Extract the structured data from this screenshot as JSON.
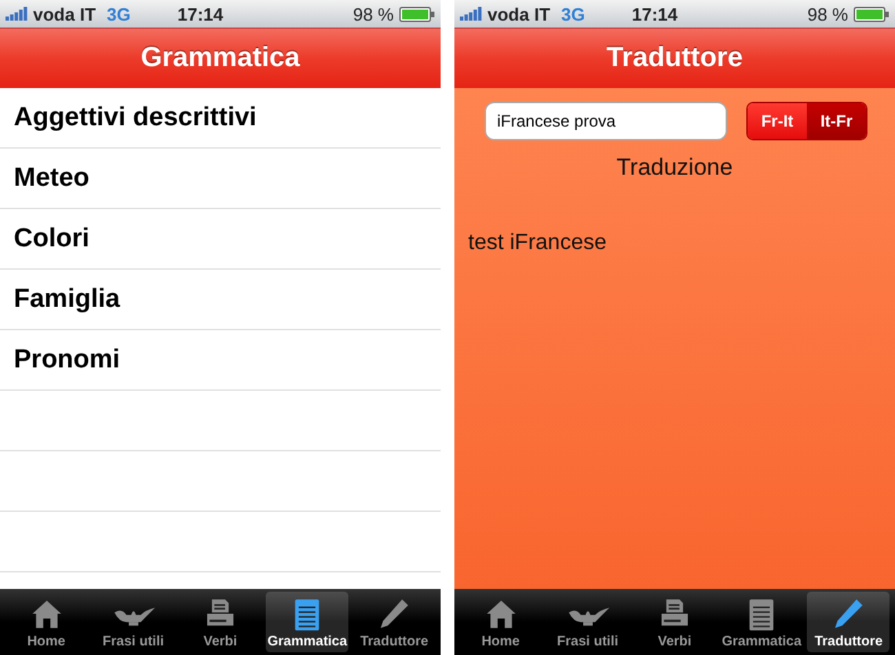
{
  "screens": [
    {
      "status_bar": {
        "carrier": "voda IT",
        "network": "3G",
        "time": "17:14",
        "battery": "98 %"
      },
      "nav_bar": {
        "title": "Grammatica"
      },
      "kind": "list",
      "list": {
        "items": [
          "Aggettivi descrittivi",
          "Meteo",
          "Colori",
          "Famiglia",
          "Pronomi"
        ]
      },
      "tab_bar": [
        {
          "label": "Home",
          "kind": "home",
          "selected": false
        },
        {
          "label": "Frasi utili",
          "kind": "lamp",
          "selected": false
        },
        {
          "label": "Verbi",
          "kind": "printer",
          "selected": false
        },
        {
          "label": "Grammatica",
          "kind": "notepad",
          "selected": true
        },
        {
          "label": "Traduttore",
          "kind": "pencil",
          "selected": false
        }
      ]
    },
    {
      "status_bar": {
        "carrier": "voda IT",
        "network": "3G",
        "time": "17:14",
        "battery": "98 %"
      },
      "nav_bar": {
        "title": "Traduttore"
      },
      "kind": "translator",
      "translator": {
        "input": {
          "value": "iFrancese prova"
        },
        "segments": [
          {
            "label": "Fr-It",
            "selected": false
          },
          {
            "label": "It-Fr",
            "selected": true
          }
        ],
        "heading": "Traduzione",
        "result": "test iFrancese"
      },
      "tab_bar": [
        {
          "label": "Home",
          "kind": "home",
          "selected": false
        },
        {
          "label": "Frasi utili",
          "kind": "lamp",
          "selected": false
        },
        {
          "label": "Verbi",
          "kind": "printer",
          "selected": false
        },
        {
          "label": "Grammatica",
          "kind": "notepad",
          "selected": false
        },
        {
          "label": "Traduttore",
          "kind": "pencil",
          "selected": true
        }
      ]
    }
  ]
}
